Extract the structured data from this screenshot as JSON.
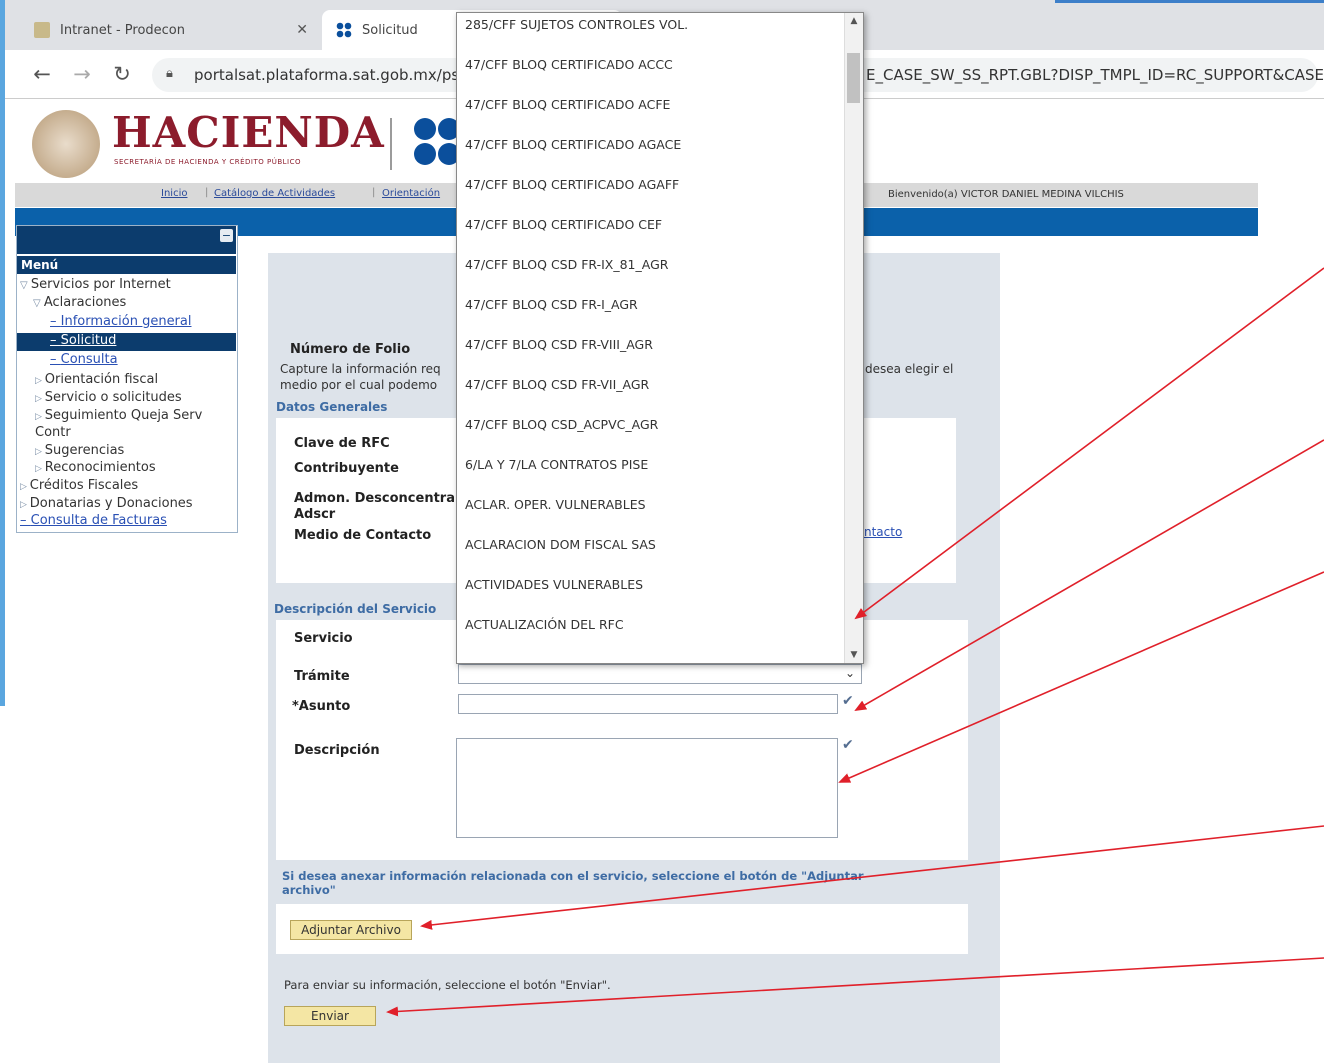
{
  "browser": {
    "tabs": [
      {
        "title": "Intranet - Prodecon",
        "close": "✕"
      },
      {
        "title": "Solicitud"
      }
    ],
    "url": "portalsat.plataforma.sat.gob.mx/ps",
    "url_tail": "E_CASE_SW_SS_RPT.GBL?DISP_TMPL_ID=RC_SUPPORT&CASE"
  },
  "header": {
    "brand": "HACIENDA",
    "brand_sub": "SECRETARÍA DE HACIENDA Y CRÉDITO PÚBLICO",
    "nav": [
      "Inicio",
      "Catálogo de Actividades",
      "Orientación"
    ],
    "welcome": "Bienvenido(a) VICTOR DANIEL MEDINA VILCHIS",
    "accent": "#0b61aa"
  },
  "menu": {
    "title": "Menú",
    "items": [
      {
        "label": "Servicios por Internet"
      },
      {
        "label": "Aclaraciones"
      },
      {
        "label": "Información general"
      },
      {
        "label": "Solicitud"
      },
      {
        "label": "Consulta"
      },
      {
        "label": "Orientación fiscal"
      },
      {
        "label": "Servicio o solicitudes"
      },
      {
        "label": "Seguimiento Queja Serv"
      },
      {
        "label": "Contr"
      },
      {
        "label": "Sugerencias"
      },
      {
        "label": "Reconocimientos"
      },
      {
        "label": "Créditos Fiscales"
      },
      {
        "label": "Donatarias y Donaciones"
      },
      {
        "label": "Consulta de Facturas"
      }
    ]
  },
  "form": {
    "folio_label": "Número de Folio",
    "folio_help_1": "Capture la información req",
    "folio_help_2": "medio por el cual podemo",
    "folio_help_right": "desea elegir el",
    "datos_generales": "Datos Generales",
    "clave_rfc": "Clave de RFC",
    "contribuyente": "Contribuyente",
    "admon_1": "Admon. Desconcentra",
    "admon_2": "Adscr",
    "medio_contacto": "Medio de Contacto",
    "medio_link": "ntacto",
    "descripcion_servicio": "Descripción del Servicio",
    "servicio": "Servicio",
    "tramite": "Trámite",
    "asunto": "*Asunto",
    "descripcion": "Descripción",
    "attach_text_1": "Si desea anexar información relacionada con el servicio, seleccione el botón de \"Adjuntar",
    "attach_text_2": "archivo\"",
    "attach_button": "Adjuntar Archivo",
    "send_text": "Para enviar su información, seleccione el botón \"Enviar\".",
    "send_button": "Enviar"
  },
  "dropdown": {
    "options": [
      "285/CFF SUJETOS CONTROLES VOL.",
      "47/CFF BLOQ CERTIFICADO ACCC",
      "47/CFF BLOQ CERTIFICADO ACFE",
      "47/CFF BLOQ CERTIFICADO AGACE",
      "47/CFF BLOQ CERTIFICADO AGAFF",
      "47/CFF BLOQ CERTIFICADO CEF",
      "47/CFF BLOQ CSD FR-IX_81_AGR",
      "47/CFF BLOQ CSD FR-I_AGR",
      "47/CFF BLOQ CSD FR-VIII_AGR",
      "47/CFF BLOQ CSD FR-VII_AGR",
      "47/CFF BLOQ CSD_ACPVC_AGR",
      "6/LA Y 7/LA CONTRATOS PISE",
      "ACLAR. OPER. VULNERABLES",
      "ACLARACION DOM FISCAL SAS",
      "ACTIVIDADES VULNERABLES",
      "ACTUALIZACIÓN DEL RFC"
    ]
  },
  "annotation_color": "#e0202a"
}
